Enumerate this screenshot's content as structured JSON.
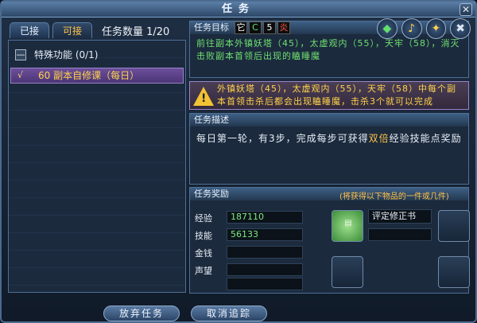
{
  "window": {
    "title": "任务",
    "close_label": "✕"
  },
  "tabs": {
    "accepted": "已接",
    "available": "可接"
  },
  "quest_count": "任务数量 1/20",
  "quest_list": {
    "category": {
      "toggle": "—",
      "label": "特殊功能 (0/1)"
    },
    "quests": [
      {
        "check": "√",
        "label": "60 副本自修课（每日）"
      }
    ]
  },
  "target": {
    "header": "任务目标",
    "marks": [
      "它",
      "C",
      "5",
      "炎"
    ],
    "text": "前往副本外镇妖塔（45），太虚观内（55），天牢（58），消灭击败副本首领后出现的瞌睡魔"
  },
  "hud_icons": [
    "green-gem-icon",
    "speaker-icon",
    "sword-icon",
    "pickaxe-icon"
  ],
  "warning": {
    "text": "外镇妖塔（45），太虚观内（55），天牢（58）中每个副本首领击杀后都会出现瞌睡魔，击杀3个就可以完成"
  },
  "description": {
    "header": "任务描述",
    "before": "每日第一轮，有3步，完成每步可获得",
    "highlight": "双倍",
    "after": "经验技能点奖励"
  },
  "reward": {
    "header": "任务奖励",
    "note": "(将获得以下物品的一件或几件)",
    "rows": [
      {
        "label": "经验",
        "value": "187110"
      },
      {
        "label": "技能",
        "value": "56133"
      },
      {
        "label": "金钱",
        "value": ""
      },
      {
        "label": "声望",
        "value": ""
      }
    ],
    "item_name": "评定修正书"
  },
  "buttons": {
    "abandon": "放弃任务",
    "untrack": "取消追踪"
  }
}
